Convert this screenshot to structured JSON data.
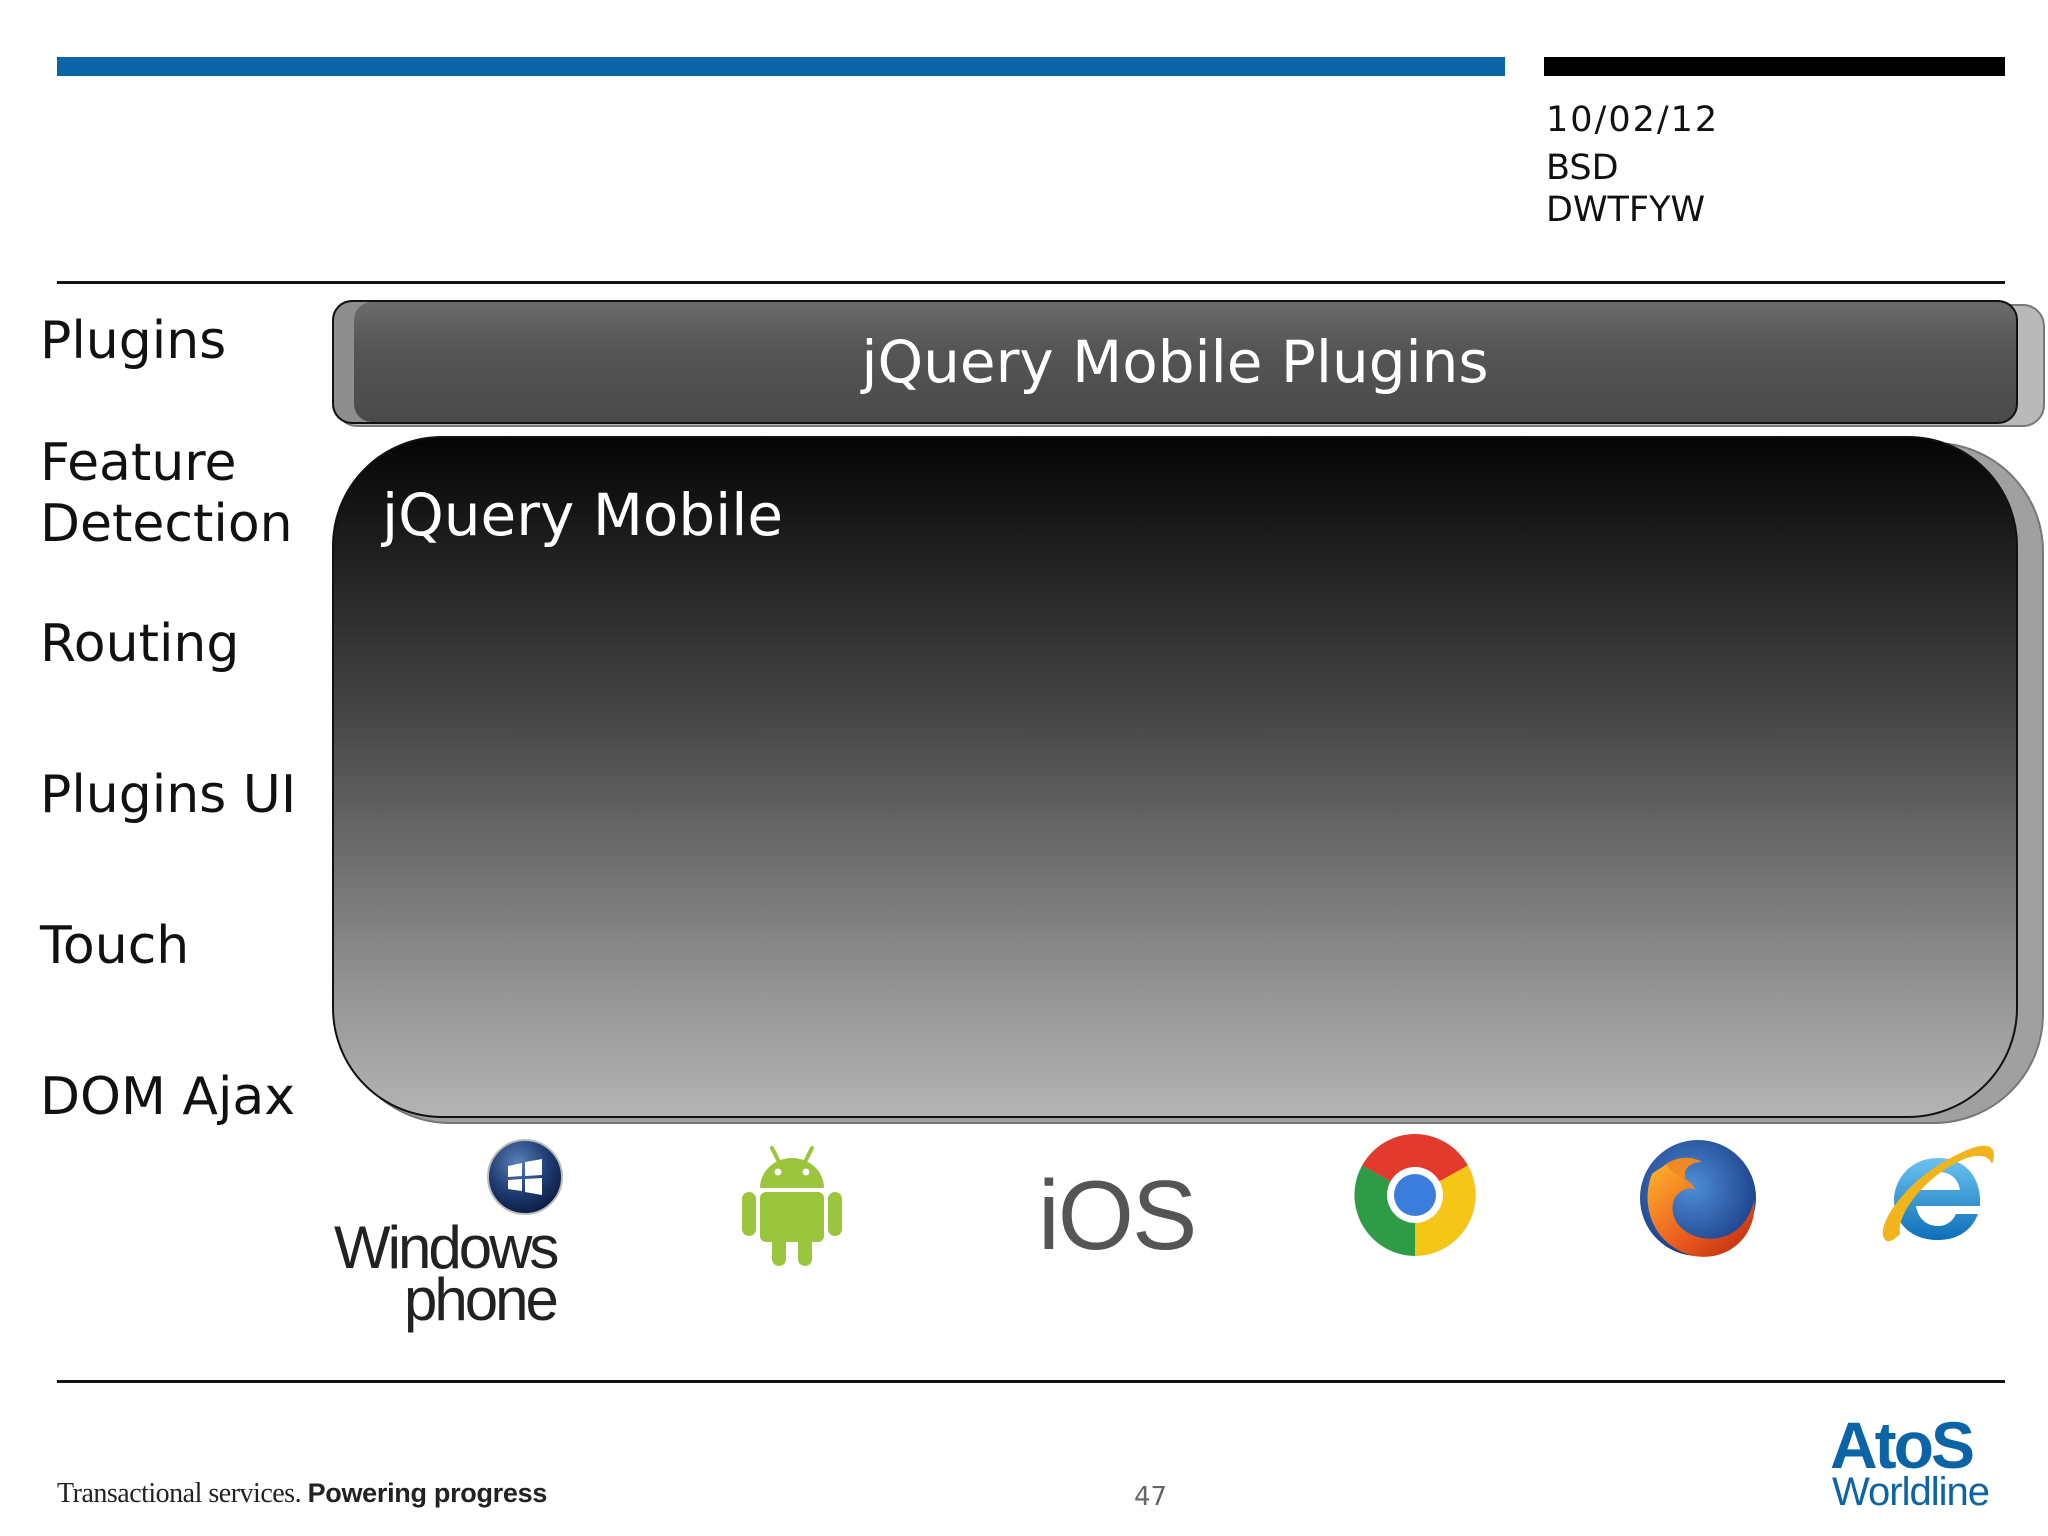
{
  "header": {
    "date": "10/02/12",
    "line1": "BSD",
    "line2": "DWTFYW"
  },
  "layers": {
    "plugins": "Plugins",
    "feature_detection_1": "Feature",
    "feature_detection_2": "Detection",
    "routing": "Routing",
    "plugins_ui": "Plugins UI",
    "touch": "Touch",
    "dom_ajax": "DOM Ajax"
  },
  "stack": {
    "plugins_bar": "jQuery Mobile Plugins",
    "core_box": "jQuery Mobile"
  },
  "platforms": {
    "windows_phone_1": "Windows",
    "windows_phone_2": "phone",
    "ios": "iOS",
    "icons": [
      "windows-phone-icon",
      "android-icon",
      "ios-logo",
      "chrome-icon",
      "firefox-icon",
      "internet-explorer-icon"
    ]
  },
  "footer": {
    "tagline_regular": "Transactional services.",
    "tagline_bold": "Powering progress",
    "page_number": "47",
    "brand": "AtoS",
    "brand_sub": "Worldline"
  },
  "colors": {
    "accent_blue": "#0b64a6",
    "bar_black": "#000000"
  }
}
